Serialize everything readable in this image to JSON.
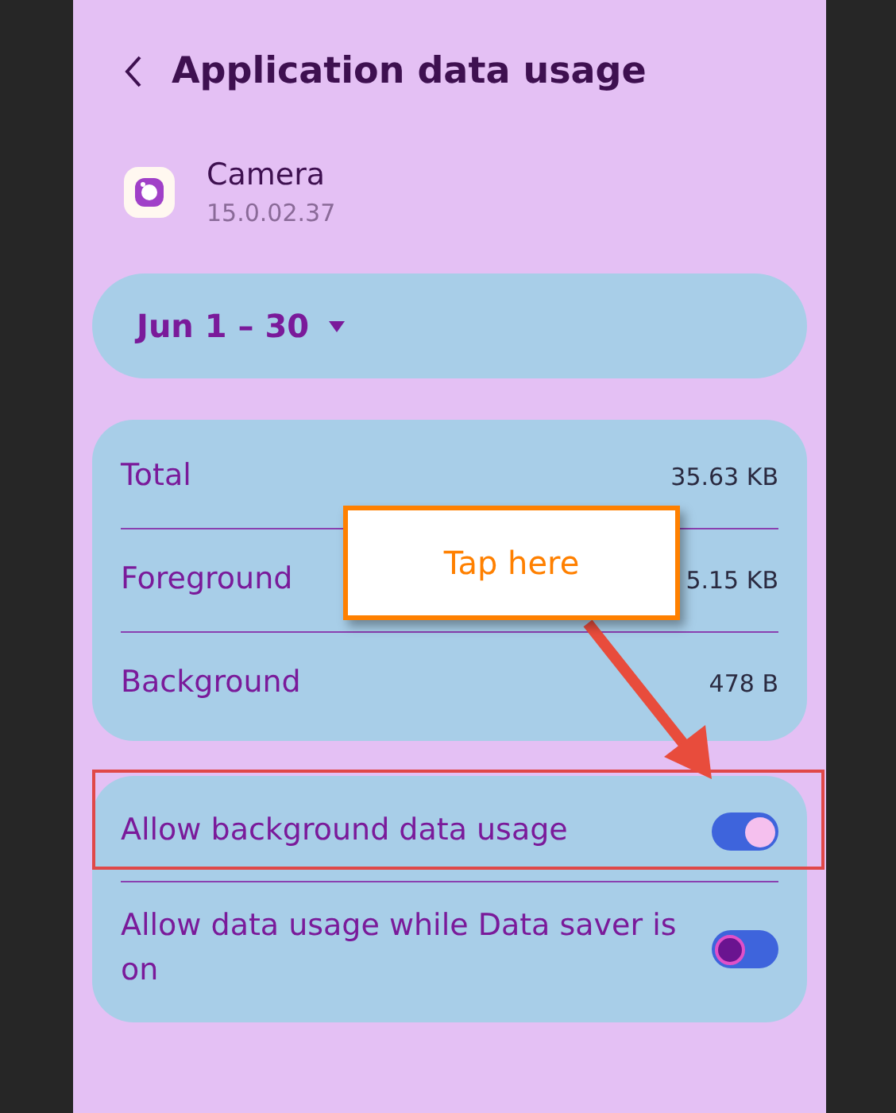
{
  "header": {
    "title": "Application data usage"
  },
  "app": {
    "name": "Camera",
    "version": "15.0.02.37"
  },
  "period": {
    "label": "Jun 1 – 30"
  },
  "usage": [
    {
      "label": "Total",
      "value": "35.63 KB"
    },
    {
      "label": "Foreground",
      "value": "5.15 KB"
    },
    {
      "label": "Background",
      "value": "478 B"
    }
  ],
  "settings": [
    {
      "label": "Allow background data usage",
      "on": true
    },
    {
      "label": "Allow data usage while Data saver is on",
      "on": false
    }
  ],
  "annotation": {
    "text": "Tap here"
  }
}
